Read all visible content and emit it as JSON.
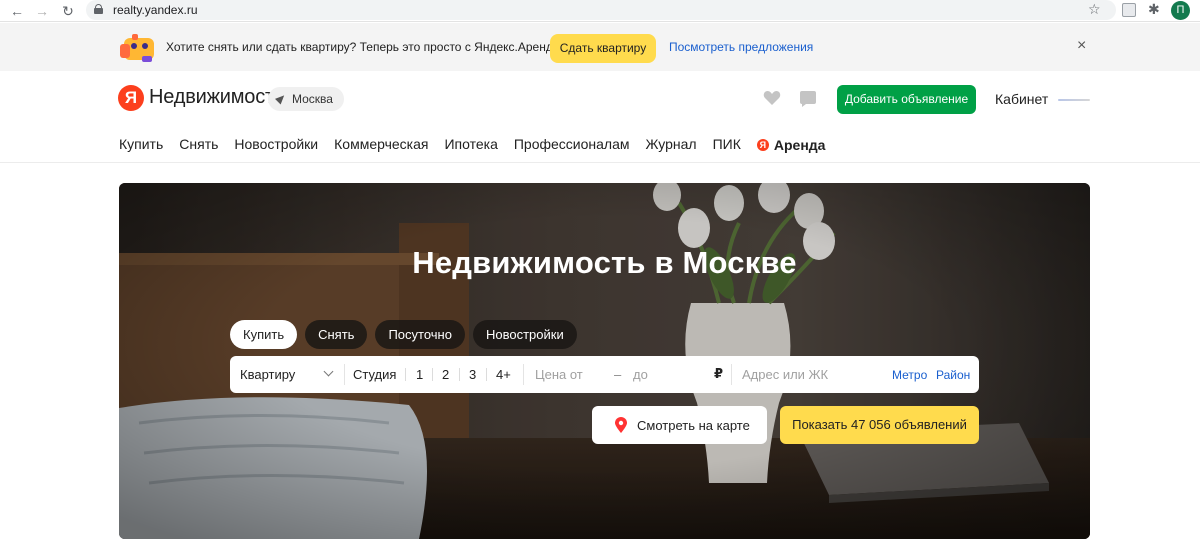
{
  "browser": {
    "url": "realty.yandex.ru",
    "profile_initial": "П"
  },
  "promo": {
    "text": "Хотите снять или сдать квартиру? Теперь это просто с Яндекс.Арендой!",
    "button_label": "Сдать квартиру",
    "link_label": "Посмотреть предложения",
    "close_label": "×"
  },
  "header": {
    "logo_letter": "Я",
    "logo_text": "Недвижимость",
    "city": "Москва",
    "add_button_label": "Добавить объявление",
    "cabinet_label": "Кабинет"
  },
  "nav": {
    "items": [
      "Купить",
      "Снять",
      "Новостройки",
      "Коммерческая",
      "Ипотека",
      "Профессионалам",
      "Журнал",
      "ПИК"
    ],
    "arenda_icon_letter": "Я",
    "arenda_label": "Аренда"
  },
  "hero": {
    "title": "Недвижимость в Москве",
    "tabs": [
      "Купить",
      "Снять",
      "Посуточно",
      "Новостройки"
    ],
    "active_tab": "Купить",
    "search": {
      "type_value": "Квартиру",
      "rooms": [
        "Студия",
        "1",
        "2",
        "3",
        "4+"
      ],
      "price_from_placeholder": "Цена от",
      "price_dash": "–",
      "price_to_placeholder": "до",
      "currency": "₽",
      "address_placeholder": "Адрес или ЖК",
      "metro_label": "Метро",
      "district_label": "Район"
    },
    "map_button_label": "Смотреть на карте",
    "show_button_label": "Показать 47 056 объявлений"
  },
  "colors": {
    "yandex_red": "#fc3f1d",
    "accent_yellow": "#ffdb4d",
    "add_green": "#00a046",
    "link_blue": "#1a5fce"
  }
}
